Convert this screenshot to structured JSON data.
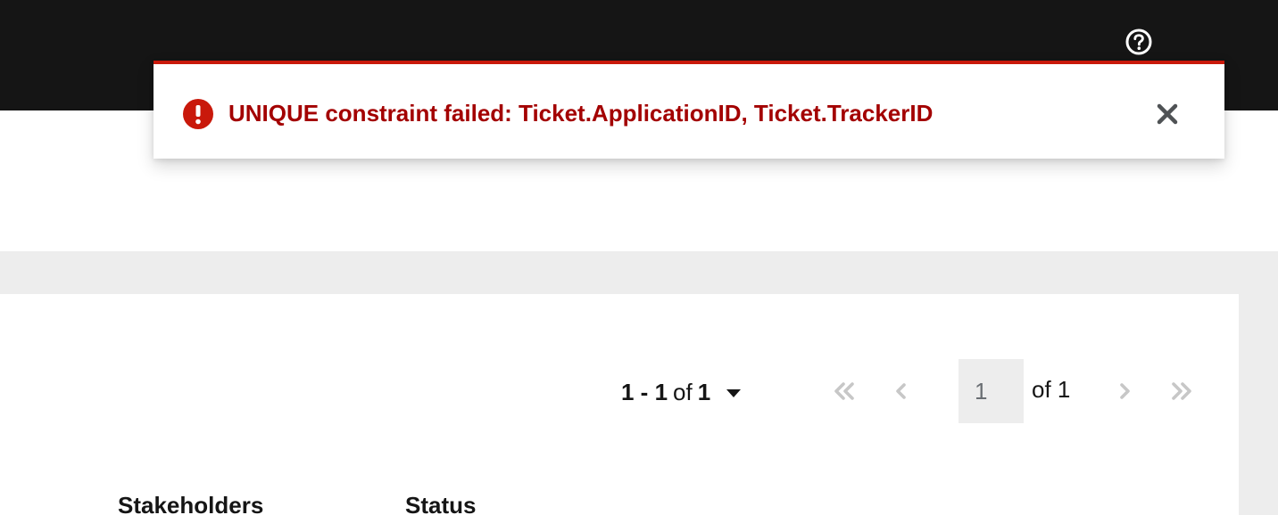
{
  "alert": {
    "title": "UNIQUE constraint failed: Ticket.ApplicationID, Ticket.TrackerID",
    "icon": "exclamation-circle-icon",
    "close_icon": "close-icon",
    "color": "#c9190b",
    "text_color": "#a30000"
  },
  "masthead": {
    "help_icon": "question-circle-icon",
    "background": "#151515"
  },
  "pagination": {
    "range": "1 - 1",
    "of_word": "of",
    "total": "1",
    "current_page": "1",
    "page_of": "of 1",
    "first_icon": "angle-double-left-icon",
    "prev_icon": "angle-left-icon",
    "next_icon": "angle-right-icon",
    "last_icon": "angle-double-right-icon"
  },
  "table": {
    "columns": [
      "Stakeholders",
      "Status"
    ]
  }
}
